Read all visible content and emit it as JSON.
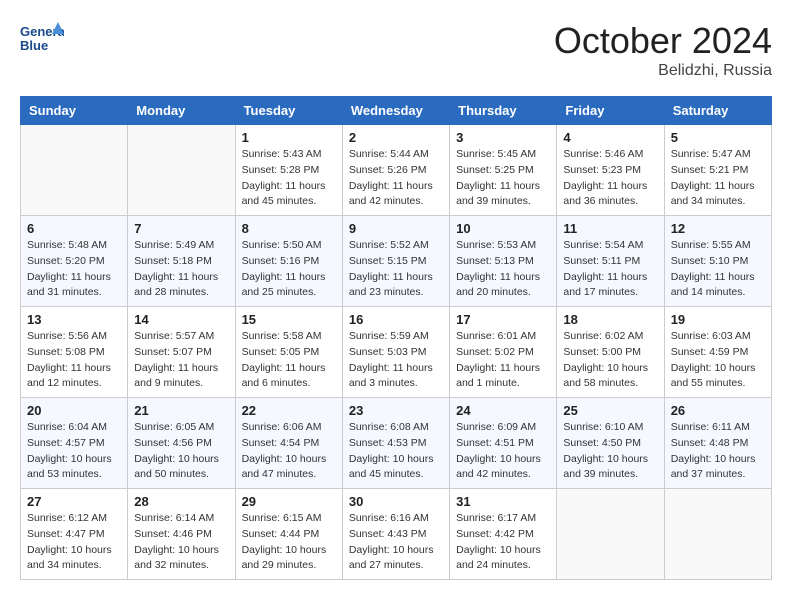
{
  "header": {
    "logo_general": "General",
    "logo_blue": "Blue",
    "month_year": "October 2024",
    "location": "Belidzhi, Russia"
  },
  "weekdays": [
    "Sunday",
    "Monday",
    "Tuesday",
    "Wednesday",
    "Thursday",
    "Friday",
    "Saturday"
  ],
  "weeks": [
    [
      {
        "day": "",
        "empty": true
      },
      {
        "day": "",
        "empty": true
      },
      {
        "day": "1",
        "sunrise": "5:43 AM",
        "sunset": "5:28 PM",
        "daylight": "11 hours and 45 minutes."
      },
      {
        "day": "2",
        "sunrise": "5:44 AM",
        "sunset": "5:26 PM",
        "daylight": "11 hours and 42 minutes."
      },
      {
        "day": "3",
        "sunrise": "5:45 AM",
        "sunset": "5:25 PM",
        "daylight": "11 hours and 39 minutes."
      },
      {
        "day": "4",
        "sunrise": "5:46 AM",
        "sunset": "5:23 PM",
        "daylight": "11 hours and 36 minutes."
      },
      {
        "day": "5",
        "sunrise": "5:47 AM",
        "sunset": "5:21 PM",
        "daylight": "11 hours and 34 minutes."
      }
    ],
    [
      {
        "day": "6",
        "sunrise": "5:48 AM",
        "sunset": "5:20 PM",
        "daylight": "11 hours and 31 minutes."
      },
      {
        "day": "7",
        "sunrise": "5:49 AM",
        "sunset": "5:18 PM",
        "daylight": "11 hours and 28 minutes."
      },
      {
        "day": "8",
        "sunrise": "5:50 AM",
        "sunset": "5:16 PM",
        "daylight": "11 hours and 25 minutes."
      },
      {
        "day": "9",
        "sunrise": "5:52 AM",
        "sunset": "5:15 PM",
        "daylight": "11 hours and 23 minutes."
      },
      {
        "day": "10",
        "sunrise": "5:53 AM",
        "sunset": "5:13 PM",
        "daylight": "11 hours and 20 minutes."
      },
      {
        "day": "11",
        "sunrise": "5:54 AM",
        "sunset": "5:11 PM",
        "daylight": "11 hours and 17 minutes."
      },
      {
        "day": "12",
        "sunrise": "5:55 AM",
        "sunset": "5:10 PM",
        "daylight": "11 hours and 14 minutes."
      }
    ],
    [
      {
        "day": "13",
        "sunrise": "5:56 AM",
        "sunset": "5:08 PM",
        "daylight": "11 hours and 12 minutes."
      },
      {
        "day": "14",
        "sunrise": "5:57 AM",
        "sunset": "5:07 PM",
        "daylight": "11 hours and 9 minutes."
      },
      {
        "day": "15",
        "sunrise": "5:58 AM",
        "sunset": "5:05 PM",
        "daylight": "11 hours and 6 minutes."
      },
      {
        "day": "16",
        "sunrise": "5:59 AM",
        "sunset": "5:03 PM",
        "daylight": "11 hours and 3 minutes."
      },
      {
        "day": "17",
        "sunrise": "6:01 AM",
        "sunset": "5:02 PM",
        "daylight": "11 hours and 1 minute."
      },
      {
        "day": "18",
        "sunrise": "6:02 AM",
        "sunset": "5:00 PM",
        "daylight": "10 hours and 58 minutes."
      },
      {
        "day": "19",
        "sunrise": "6:03 AM",
        "sunset": "4:59 PM",
        "daylight": "10 hours and 55 minutes."
      }
    ],
    [
      {
        "day": "20",
        "sunrise": "6:04 AM",
        "sunset": "4:57 PM",
        "daylight": "10 hours and 53 minutes."
      },
      {
        "day": "21",
        "sunrise": "6:05 AM",
        "sunset": "4:56 PM",
        "daylight": "10 hours and 50 minutes."
      },
      {
        "day": "22",
        "sunrise": "6:06 AM",
        "sunset": "4:54 PM",
        "daylight": "10 hours and 47 minutes."
      },
      {
        "day": "23",
        "sunrise": "6:08 AM",
        "sunset": "4:53 PM",
        "daylight": "10 hours and 45 minutes."
      },
      {
        "day": "24",
        "sunrise": "6:09 AM",
        "sunset": "4:51 PM",
        "daylight": "10 hours and 42 minutes."
      },
      {
        "day": "25",
        "sunrise": "6:10 AM",
        "sunset": "4:50 PM",
        "daylight": "10 hours and 39 minutes."
      },
      {
        "day": "26",
        "sunrise": "6:11 AM",
        "sunset": "4:48 PM",
        "daylight": "10 hours and 37 minutes."
      }
    ],
    [
      {
        "day": "27",
        "sunrise": "6:12 AM",
        "sunset": "4:47 PM",
        "daylight": "10 hours and 34 minutes."
      },
      {
        "day": "28",
        "sunrise": "6:14 AM",
        "sunset": "4:46 PM",
        "daylight": "10 hours and 32 minutes."
      },
      {
        "day": "29",
        "sunrise": "6:15 AM",
        "sunset": "4:44 PM",
        "daylight": "10 hours and 29 minutes."
      },
      {
        "day": "30",
        "sunrise": "6:16 AM",
        "sunset": "4:43 PM",
        "daylight": "10 hours and 27 minutes."
      },
      {
        "day": "31",
        "sunrise": "6:17 AM",
        "sunset": "4:42 PM",
        "daylight": "10 hours and 24 minutes."
      },
      {
        "day": "",
        "empty": true
      },
      {
        "day": "",
        "empty": true
      }
    ]
  ]
}
